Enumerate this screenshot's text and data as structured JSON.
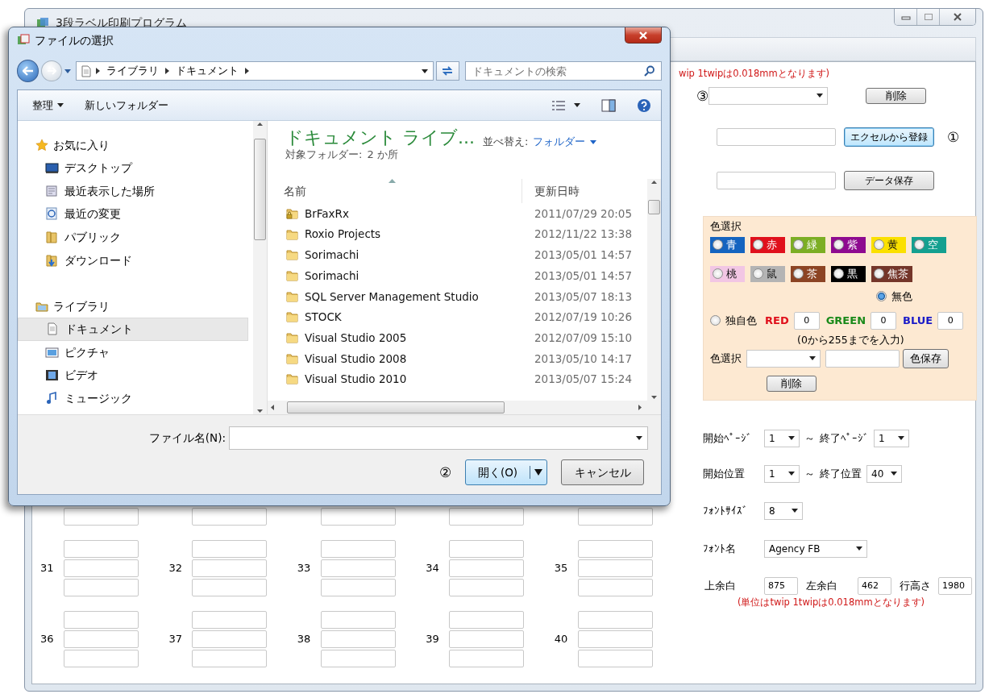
{
  "main_window": {
    "title": "3段ラベル印刷プログラム",
    "label_rows": [
      {
        "numbers": [
          "31",
          "32",
          "33",
          "34",
          "35"
        ]
      },
      {
        "numbers": [
          "36",
          "37",
          "38",
          "39",
          "40"
        ]
      }
    ],
    "top_note": "wip 1twipは0.018mmとなります)",
    "list_row": {
      "marker": "③",
      "button": "削除"
    },
    "excel_row": {
      "button": "エクセルから登録",
      "focused": true,
      "marker": "①"
    },
    "save_row": {
      "button": "データ保存",
      "focused": false
    },
    "color_panel": {
      "legend": "色選択",
      "chips": [
        {
          "label": "青",
          "color": "#1464c0",
          "selected": false
        },
        {
          "label": "赤",
          "color": "#e0101c",
          "selected": false
        },
        {
          "label": "緑",
          "color": "#7cae24",
          "selected": false
        },
        {
          "label": "紫",
          "color": "#8e0a90",
          "selected": false
        },
        {
          "label": "黄",
          "color": "#fbe000",
          "selected": false
        },
        {
          "label": "空",
          "color": "#14a090",
          "selected": false
        },
        {
          "label": "桃",
          "color": "#f2c6e4",
          "selected": false
        },
        {
          "label": "鼠",
          "color": "#b4b4b4",
          "selected": false
        },
        {
          "label": "茶",
          "color": "#8c4424",
          "selected": false
        },
        {
          "label": "黒",
          "color": "#000000",
          "selected": false
        },
        {
          "label": "焦茶",
          "color": "#74362a",
          "selected": false
        }
      ],
      "no_color": {
        "label": "無色",
        "selected": true
      },
      "custom": {
        "label": "独自色",
        "selected": false,
        "channels": [
          {
            "label": "RED",
            "value": "0"
          },
          {
            "label": "GREEN",
            "value": "0"
          },
          {
            "label": "BLUE",
            "value": "0"
          }
        ]
      },
      "range_hint": "(0から255までを入力)",
      "select_label": "色選択",
      "save_button": "色保存",
      "delete_button": "削除"
    },
    "page_range": {
      "start_label": "開始ﾍﾟｰｼﾞ",
      "start": "1",
      "tilde": "～",
      "end_label": "終了ﾍﾟｰｼﾞ",
      "end": "1"
    },
    "position_range": {
      "start_label": "開始位置",
      "start": "1",
      "tilde": "～",
      "end_label": "終了位置",
      "end": "40"
    },
    "font_size": {
      "label": "ﾌｫﾝﾄｻｲｽﾞ",
      "value": "8"
    },
    "font_name": {
      "label": "ﾌｫﾝﾄ名",
      "value": "Agency FB"
    },
    "margins": [
      {
        "label": "上余白",
        "value": "875"
      },
      {
        "label": "左余白",
        "value": "462"
      },
      {
        "label": "行高さ",
        "value": "1980"
      }
    ],
    "unit_note": "(単位はtwip 1twipは0.018mmとなります)"
  },
  "dialog": {
    "title": "ファイルの選択",
    "breadcrumb": [
      "ライブラリ",
      "ドキュメント"
    ],
    "search_placeholder": "ドキュメントの検索",
    "toolbar": {
      "organize": "整理",
      "new_folder": "新しいフォルダー"
    },
    "nav": [
      {
        "label": "お気に入り",
        "children": [
          {
            "label": "デスクトップ",
            "selected": false
          },
          {
            "label": "最近表示した場所",
            "selected": false
          },
          {
            "label": "最近の変更",
            "selected": false
          },
          {
            "label": "パブリック",
            "selected": false
          },
          {
            "label": "ダウンロード",
            "selected": false
          }
        ]
      },
      {
        "label": "ライブラリ",
        "children": [
          {
            "label": "ドキュメント",
            "selected": true
          },
          {
            "label": "ピクチャ",
            "selected": false
          },
          {
            "label": "ビデオ",
            "selected": false
          },
          {
            "label": "ミュージック",
            "selected": false
          }
        ]
      }
    ],
    "library_title": "ドキュメント ライブ...",
    "target_label": "対象フォルダー:",
    "target_link": "2 か所",
    "sort_label": "並べ替え:",
    "sort_value": "フォルダー",
    "columns": [
      "名前",
      "更新日時"
    ],
    "files": [
      {
        "kind": "locked_folder",
        "name": "BrFaxRx",
        "modified": "2011/07/29 20:05"
      },
      {
        "kind": "folder",
        "name": "Roxio Projects",
        "modified": "2012/11/22 13:38"
      },
      {
        "kind": "folder",
        "name": "Sorimachi",
        "modified": "2013/05/01 14:57"
      },
      {
        "kind": "folder",
        "name": "Sorimachi",
        "modified": "2013/05/01 14:57"
      },
      {
        "kind": "folder",
        "name": "SQL Server Management Studio",
        "modified": "2013/05/07 18:13"
      },
      {
        "kind": "folder",
        "name": "STOCK",
        "modified": "2012/07/19 10:26"
      },
      {
        "kind": "folder",
        "name": "Visual Studio 2005",
        "modified": "2012/07/09 15:10"
      },
      {
        "kind": "folder",
        "name": "Visual Studio 2008",
        "modified": "2013/05/10 14:17"
      },
      {
        "kind": "folder",
        "name": "Visual Studio 2010",
        "modified": "2013/05/07 15:24"
      }
    ],
    "filename_label": "ファイル名(N):",
    "marker": "②",
    "open_button": "開く(O)",
    "cancel_button": "キャンセル"
  }
}
